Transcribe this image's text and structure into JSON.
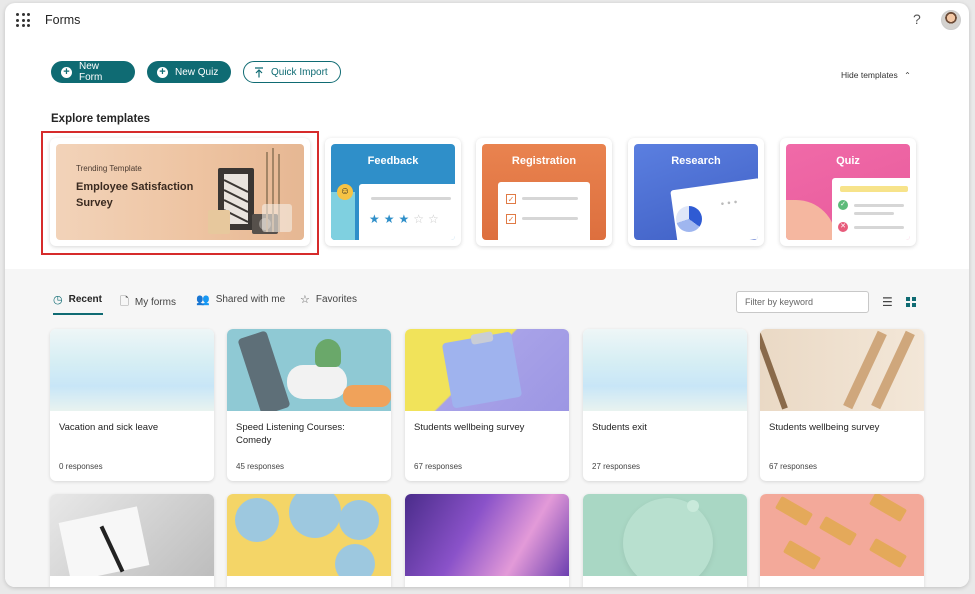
{
  "header": {
    "app_title": "Forms",
    "help_label": "?"
  },
  "actions": {
    "new_form": "New Form",
    "new_quiz": "New Quiz",
    "quick_import": "Quick Import",
    "hide_templates": "Hide templates"
  },
  "templates": {
    "heading": "Explore templates",
    "trending": {
      "tag": "Trending Template",
      "title": "Employee Satisfaction Survey"
    },
    "items": [
      {
        "label": "Feedback",
        "color": "#2f8fc9"
      },
      {
        "label": "Registration",
        "color": "#e07a45"
      },
      {
        "label": "Research",
        "color": "#4a6fd1"
      },
      {
        "label": "Quiz",
        "color": "#e8589a"
      }
    ]
  },
  "tabs": [
    {
      "label": "Recent",
      "icon": "clock-icon"
    },
    {
      "label": "My forms",
      "icon": "document-icon"
    },
    {
      "label": "Shared with me",
      "icon": "people-icon"
    },
    {
      "label": "Favorites",
      "icon": "star-icon"
    }
  ],
  "filter": {
    "placeholder": "Filter by keyword"
  },
  "forms": [
    {
      "title": "Vacation and sick leave",
      "responses": "0 responses"
    },
    {
      "title": "Speed Listening Courses: Comedy",
      "responses": "45 responses"
    },
    {
      "title": "Students wellbeing survey",
      "responses": "67 responses"
    },
    {
      "title": "Students exit",
      "responses": "27 responses"
    },
    {
      "title": "Students wellbeing survey",
      "responses": "67 responses"
    }
  ]
}
